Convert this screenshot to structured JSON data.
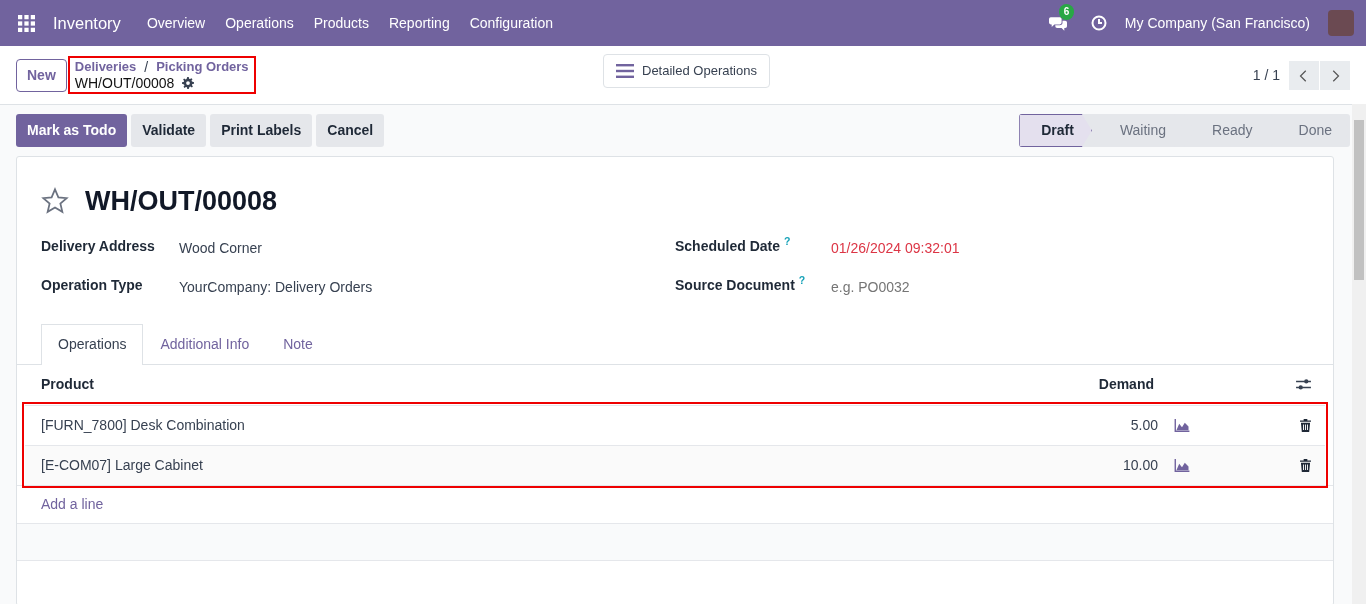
{
  "navbar": {
    "app": "Inventory",
    "menu": [
      "Overview",
      "Operations",
      "Products",
      "Reporting",
      "Configuration"
    ],
    "message_count": "6",
    "company": "My Company (San Francisco)"
  },
  "control_panel": {
    "new_button": "New",
    "breadcrumb": [
      "Deliveries",
      "Picking Orders"
    ],
    "separator": "/",
    "record": "WH/OUT/00008",
    "highlighted": true,
    "view_button": "Detailed Operations",
    "pager": "1 / 1"
  },
  "actions": [
    {
      "label": "Mark as Todo",
      "primary": true
    },
    {
      "label": "Validate",
      "primary": false
    },
    {
      "label": "Print Labels",
      "primary": false
    },
    {
      "label": "Cancel",
      "primary": false
    }
  ],
  "status_steps": [
    {
      "label": "Draft",
      "selected": true
    },
    {
      "label": "Waiting",
      "selected": false
    },
    {
      "label": "Ready",
      "selected": false
    },
    {
      "label": "Done",
      "selected": false
    }
  ],
  "sheet": {
    "title": "WH/OUT/00008",
    "starred": false,
    "left_fields": [
      {
        "label": "Delivery Address",
        "value": "Wood Corner"
      },
      {
        "label": "Operation Type",
        "value": "YourCompany: Delivery Orders"
      }
    ],
    "right_fields": [
      {
        "label": "Scheduled Date",
        "value": "01/26/2024 09:32:01",
        "help": "?",
        "overdue": true
      },
      {
        "label": "Source Document",
        "placeholder": "e.g. PO0032",
        "help": "?"
      }
    ],
    "tabs": [
      {
        "label": "Operations",
        "selected": true
      },
      {
        "label": "Additional Info",
        "selected": false
      },
      {
        "label": "Note",
        "selected": false
      }
    ],
    "table": {
      "columns": [
        "Product",
        "Demand"
      ],
      "highlighted": true,
      "rows": [
        {
          "product": "[FURN_7800] Desk Combination",
          "demand": "5.00"
        },
        {
          "product": "[E-COM07] Large Cabinet",
          "demand": "10.00"
        }
      ],
      "add_line": "Add a line"
    }
  }
}
